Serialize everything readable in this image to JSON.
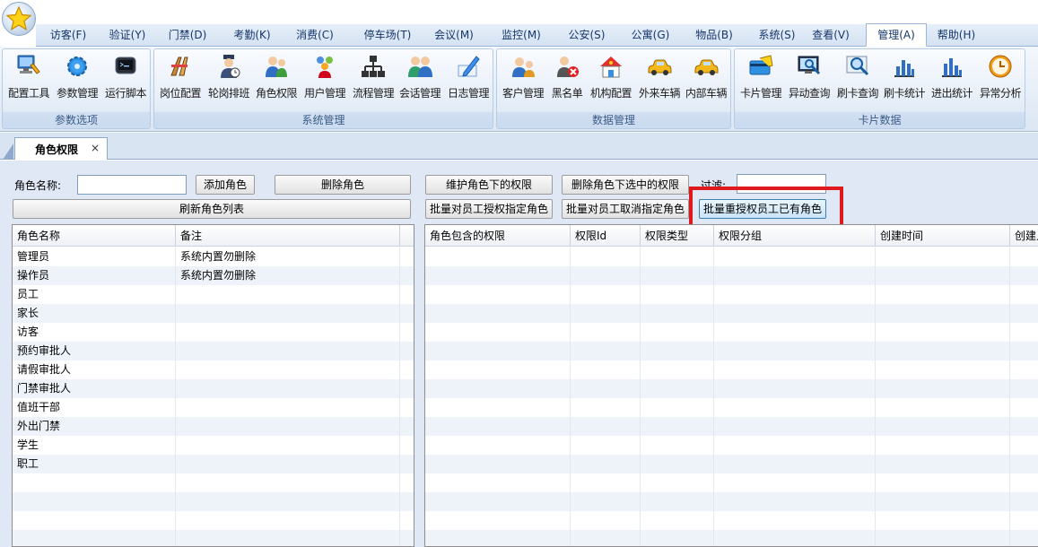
{
  "menu": {
    "tabs": [
      "访客(F)",
      "验证(Y)",
      "门禁(D)",
      "考勤(K)",
      "消费(C)",
      "停车场(T)",
      "会议(M)",
      "监控(M)",
      "公安(S)",
      "公寓(G)",
      "物品(B)",
      "系统(S)",
      "查看(V)",
      "管理(A)",
      "帮助(H)"
    ],
    "active_tab": "管理(A)"
  },
  "ribbon": {
    "groups": [
      {
        "label": "参数选项",
        "buttons": [
          {
            "label": "配置工具",
            "icon": "config-tool-icon"
          },
          {
            "label": "参数管理",
            "icon": "gear-icon"
          },
          {
            "label": "运行脚本",
            "icon": "terminal-icon"
          }
        ]
      },
      {
        "label": "系统管理",
        "buttons": [
          {
            "label": "岗位配置",
            "icon": "post-config-icon"
          },
          {
            "label": "轮岗排班",
            "icon": "guard-schedule-icon"
          },
          {
            "label": "角色权限",
            "icon": "role-users-icon"
          },
          {
            "label": "用户管理",
            "icon": "user-management-icon"
          },
          {
            "label": "流程管理",
            "icon": "org-chart-icon"
          },
          {
            "label": "会话管理",
            "icon": "session-users-icon"
          },
          {
            "label": "日志管理",
            "icon": "log-pencil-icon"
          }
        ]
      },
      {
        "label": "数据管理",
        "buttons": [
          {
            "label": "客户管理",
            "icon": "customer-icon"
          },
          {
            "label": "黑名单",
            "icon": "blacklist-icon"
          },
          {
            "label": "机构配置",
            "icon": "organization-house-icon"
          },
          {
            "label": "外来车辆",
            "icon": "car-icon"
          },
          {
            "label": "内部车辆",
            "icon": "car-icon"
          }
        ]
      },
      {
        "label": "卡片数据",
        "buttons": [
          {
            "label": "卡片管理",
            "icon": "card-icon"
          },
          {
            "label": "异动查询",
            "icon": "monitor-search-icon"
          },
          {
            "label": "刷卡查询",
            "icon": "magnifier-icon"
          },
          {
            "label": "刷卡统计",
            "icon": "bar-chart-icon"
          },
          {
            "label": "进出统计",
            "icon": "bar-chart-icon"
          },
          {
            "label": "异常分析",
            "icon": "clock-icon"
          }
        ]
      }
    ]
  },
  "doc_tab": {
    "label": "角色权限",
    "close": "×"
  },
  "toolbar": {
    "role_name_label": "角色名称:",
    "role_name_value": "",
    "add_role": "添加角色",
    "delete_role": "删除角色",
    "refresh_roles": "刷新角色列表",
    "maintain_perms": "维护角色下的权限",
    "delete_selected_perms": "删除角色下选中的权限",
    "filter_label": "过滤:",
    "filter_value": "",
    "batch_grant": "批量对员工授权指定角色",
    "batch_revoke": "批量对员工取消指定角色",
    "batch_regrant": "批量重授权员工已有角色"
  },
  "role_grid": {
    "headers": [
      "角色名称",
      "备注"
    ],
    "rows": [
      [
        "管理员",
        "系统内置勿删除"
      ],
      [
        "操作员",
        "系统内置勿删除"
      ],
      [
        "员工",
        ""
      ],
      [
        "家长",
        ""
      ],
      [
        "访客",
        ""
      ],
      [
        "预约审批人",
        ""
      ],
      [
        "请假审批人",
        ""
      ],
      [
        "门禁审批人",
        ""
      ],
      [
        "值班干部",
        ""
      ],
      [
        "外出门禁",
        ""
      ],
      [
        "学生",
        ""
      ],
      [
        "职工",
        ""
      ],
      [
        "",
        ""
      ],
      [
        "",
        ""
      ],
      [
        "",
        ""
      ],
      [
        "",
        ""
      ]
    ]
  },
  "perm_grid": {
    "headers": [
      "角色包含的权限",
      "权限Id",
      "权限类型",
      "权限分组",
      "创建时间",
      "创建人"
    ],
    "rows": [
      [
        "",
        "",
        "",
        "",
        "",
        ""
      ],
      [
        "",
        "",
        "",
        "",
        "",
        ""
      ],
      [
        "",
        "",
        "",
        "",
        "",
        ""
      ],
      [
        "",
        "",
        "",
        "",
        "",
        ""
      ],
      [
        "",
        "",
        "",
        "",
        "",
        ""
      ],
      [
        "",
        "",
        "",
        "",
        "",
        ""
      ],
      [
        "",
        "",
        "",
        "",
        "",
        ""
      ],
      [
        "",
        "",
        "",
        "",
        "",
        ""
      ],
      [
        "",
        "",
        "",
        "",
        "",
        ""
      ],
      [
        "",
        "",
        "",
        "",
        "",
        ""
      ],
      [
        "",
        "",
        "",
        "",
        "",
        ""
      ],
      [
        "",
        "",
        "",
        "",
        "",
        ""
      ],
      [
        "",
        "",
        "",
        "",
        "",
        ""
      ],
      [
        "",
        "",
        "",
        "",
        "",
        ""
      ],
      [
        "",
        "",
        "",
        "",
        "",
        ""
      ],
      [
        "",
        "",
        "",
        "",
        "",
        ""
      ]
    ]
  },
  "colors": {
    "highlight_border": "#e0191e",
    "menu_text": "#15366a",
    "ribbon_bg": "#dce7f4"
  }
}
